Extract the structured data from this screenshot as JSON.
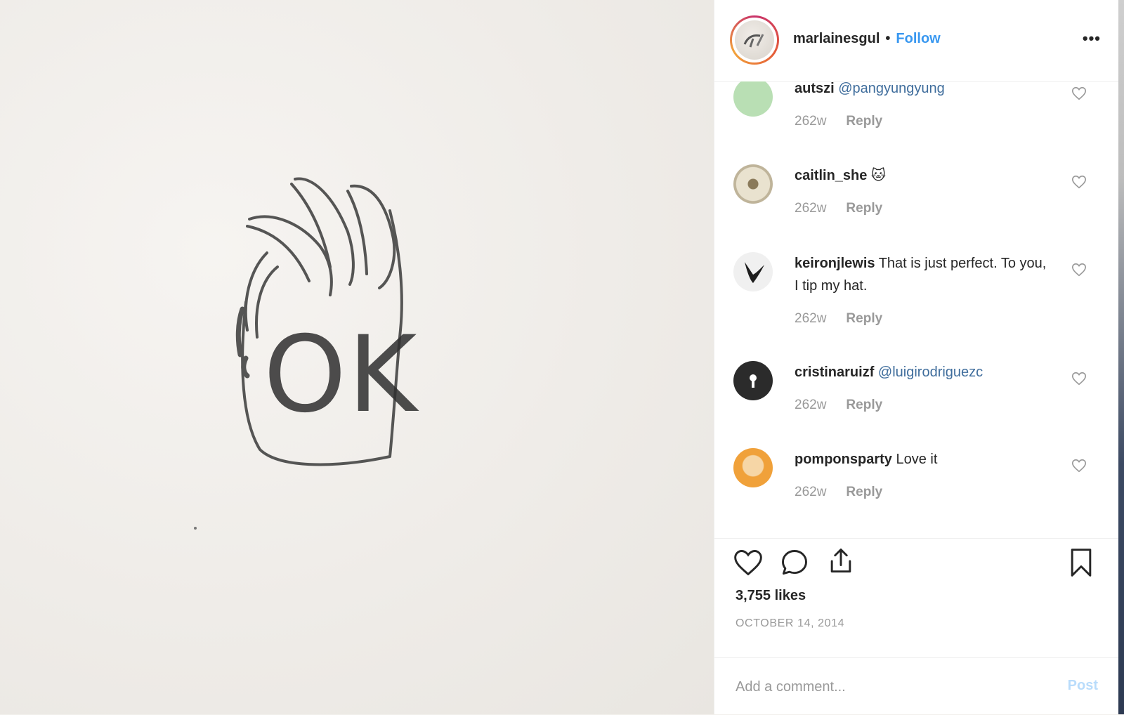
{
  "post": {
    "username": "marlainesgul",
    "separator": "•",
    "follow_label": "Follow",
    "more_icon": "•••",
    "likes_text": "3,755 likes",
    "date_text": "OCTOBER 14, 2014"
  },
  "photo": {
    "drawn_text": "OK"
  },
  "comments": [
    {
      "user": "autszi",
      "text": "",
      "mention": "@pangyungyung",
      "age": "262w",
      "reply": "Reply",
      "avatar_color": "#b9dfb4"
    },
    {
      "user": "caitlin_she",
      "text": "🐱",
      "mention": "",
      "age": "262w",
      "reply": "Reply",
      "avatar_color": "#c7bfa9"
    },
    {
      "user": "keironjlewis",
      "text": "That is just perfect. To you, I tip my hat.",
      "mention": "",
      "age": "262w",
      "reply": "Reply",
      "avatar_color": "#e9e9e9"
    },
    {
      "user": "cristinaruizf",
      "text": "",
      "mention": "@luigirodriguezc",
      "age": "262w",
      "reply": "Reply",
      "avatar_color": "#2b2b2b"
    },
    {
      "user": "pomponsparty",
      "text": "Love it",
      "mention": "",
      "age": "262w",
      "reply": "Reply",
      "avatar_color": "#f0a13a"
    }
  ],
  "add_comment": {
    "placeholder": "Add a comment...",
    "post_label": "Post"
  },
  "icons": {
    "like": "heart-icon",
    "comment": "comment-bubble-icon",
    "share": "share-icon",
    "save": "bookmark-icon"
  }
}
